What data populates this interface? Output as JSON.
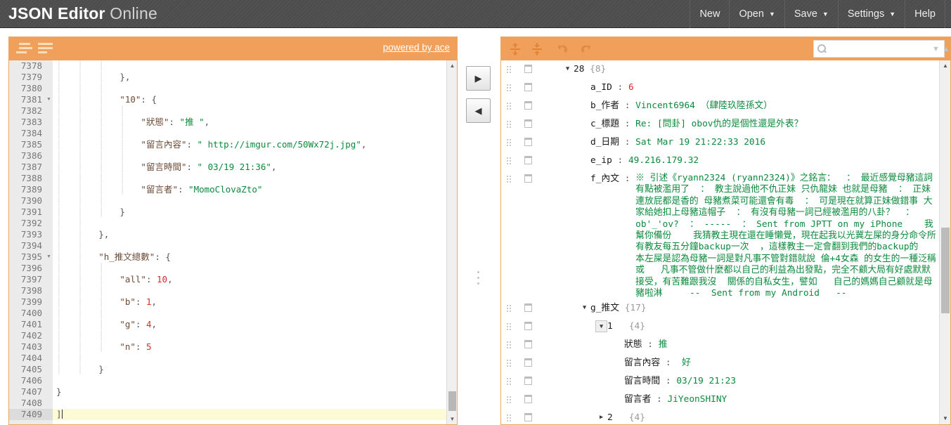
{
  "header": {
    "title_strong": "JSON Editor",
    "title_light": "Online",
    "menu": [
      {
        "label": "New",
        "caret": ""
      },
      {
        "label": "Open",
        "caret": "▼"
      },
      {
        "label": "Save",
        "caret": "▼"
      },
      {
        "label": "Settings",
        "caret": "▼"
      },
      {
        "label": "Help",
        "caret": ""
      }
    ]
  },
  "left_panel": {
    "toolbar": {
      "powered_by": "powered by ace",
      "format_icon": "format-json-icon",
      "compact_icon": "compact-json-icon"
    },
    "editor": {
      "lines": [
        {
          "no": "7378",
          "fold": "",
          "html": "<span class=\"indent-guide\">│   │   │   </span>",
          "active": false
        },
        {
          "no": "7379",
          "fold": "",
          "html": "<span class=\"indent-guide\">│   │   │   </span><span class=\"p\">},</span>",
          "active": false
        },
        {
          "no": "7380",
          "fold": "",
          "html": "<span class=\"indent-guide\">│   │   │   </span>",
          "active": false
        },
        {
          "no": "7381",
          "fold": "▼",
          "html": "<span class=\"indent-guide\">│   │   │   </span><span class=\"k\">\"10\"</span><span class=\"p\">: {</span>",
          "active": false
        },
        {
          "no": "7382",
          "fold": "",
          "html": "<span class=\"indent-guide\">│   │   │   │   </span>",
          "active": false
        },
        {
          "no": "7383",
          "fold": "",
          "html": "<span class=\"indent-guide\">│   │   │   │   </span><span class=\"k\">\"狀態\"</span><span class=\"p\">: </span><span class=\"s\">\"推 \"</span><span class=\"p\">,</span>",
          "active": false
        },
        {
          "no": "7384",
          "fold": "",
          "html": "<span class=\"indent-guide\">│   │   │   │   </span>",
          "active": false
        },
        {
          "no": "7385",
          "fold": "",
          "html": "<span class=\"indent-guide\">│   │   │   │   </span><span class=\"k\">\"留言內容\"</span><span class=\"p\">: </span><span class=\"s\">\" http://imgur.com/50Wx72j.jpg\"</span><span class=\"p\">,</span>",
          "active": false
        },
        {
          "no": "7386",
          "fold": "",
          "html": "<span class=\"indent-guide\">│   │   │   │   </span>",
          "active": false
        },
        {
          "no": "7387",
          "fold": "",
          "html": "<span class=\"indent-guide\">│   │   │   │   </span><span class=\"k\">\"留言時間\"</span><span class=\"p\">: </span><span class=\"s\">\" 03/19 21:36\"</span><span class=\"p\">,</span>",
          "active": false
        },
        {
          "no": "7388",
          "fold": "",
          "html": "<span class=\"indent-guide\">│   │   │   │   </span>",
          "active": false
        },
        {
          "no": "7389",
          "fold": "",
          "html": "<span class=\"indent-guide\">│   │   │   │   </span><span class=\"k\">\"留言者\"</span><span class=\"p\">: </span><span class=\"s\">\"MomoClovaZto\"</span>",
          "active": false
        },
        {
          "no": "7390",
          "fold": "",
          "html": "<span class=\"indent-guide\">│   │   │   </span>",
          "active": false
        },
        {
          "no": "7391",
          "fold": "",
          "html": "<span class=\"indent-guide\">│   │   │   </span><span class=\"p\">}</span>",
          "active": false
        },
        {
          "no": "7392",
          "fold": "",
          "html": "<span class=\"indent-guide\">│   │   </span>",
          "active": false
        },
        {
          "no": "7393",
          "fold": "",
          "html": "<span class=\"indent-guide\">│   │   </span><span class=\"p\">},</span>",
          "active": false
        },
        {
          "no": "7394",
          "fold": "",
          "html": "<span class=\"indent-guide\">│   │   </span>",
          "active": false
        },
        {
          "no": "7395",
          "fold": "▼",
          "html": "<span class=\"indent-guide\">│   │   </span><span class=\"k\">\"h_推文總數\"</span><span class=\"p\">: {</span>",
          "active": false
        },
        {
          "no": "7396",
          "fold": "",
          "html": "<span class=\"indent-guide\">│   │   │   </span>",
          "active": false
        },
        {
          "no": "7397",
          "fold": "",
          "html": "<span class=\"indent-guide\">│   │   │   </span><span class=\"k\">\"all\"</span><span class=\"p\">: </span><span class=\"n\">10</span><span class=\"p\">,</span>",
          "active": false
        },
        {
          "no": "7398",
          "fold": "",
          "html": "<span class=\"indent-guide\">│   │   │   </span>",
          "active": false
        },
        {
          "no": "7399",
          "fold": "",
          "html": "<span class=\"indent-guide\">│   │   │   </span><span class=\"k\">\"b\"</span><span class=\"p\">: </span><span class=\"n\">1</span><span class=\"p\">,</span>",
          "active": false
        },
        {
          "no": "7400",
          "fold": "",
          "html": "<span class=\"indent-guide\">│   │   │   </span>",
          "active": false
        },
        {
          "no": "7401",
          "fold": "",
          "html": "<span class=\"indent-guide\">│   │   │   </span><span class=\"k\">\"g\"</span><span class=\"p\">: </span><span class=\"n\">4</span><span class=\"p\">,</span>",
          "active": false
        },
        {
          "no": "7402",
          "fold": "",
          "html": "<span class=\"indent-guide\">│   │   │   </span>",
          "active": false
        },
        {
          "no": "7403",
          "fold": "",
          "html": "<span class=\"indent-guide\">│   │   │   </span><span class=\"k\">\"n\"</span><span class=\"p\">: </span><span class=\"n\">5</span>",
          "active": false
        },
        {
          "no": "7404",
          "fold": "",
          "html": "<span class=\"indent-guide\">│   │   </span>",
          "active": false
        },
        {
          "no": "7405",
          "fold": "",
          "html": "<span class=\"indent-guide\">│   │   </span><span class=\"p\">}</span>",
          "active": false
        },
        {
          "no": "7406",
          "fold": "",
          "html": "",
          "active": false
        },
        {
          "no": "7407",
          "fold": "",
          "html": "<span class=\"p\">}</span>",
          "active": false
        },
        {
          "no": "7408",
          "fold": "",
          "html": "",
          "active": false
        },
        {
          "no": "7409",
          "fold": "",
          "html": "<span class=\"p\">]</span><span class=\"caret-bar\"></span>",
          "active": true
        }
      ]
    }
  },
  "transfer": {
    "to_tree_label": "▶",
    "to_code_label": "◀"
  },
  "right_panel": {
    "toolbar": {
      "expand_all": "expand-all-icon",
      "collapse_all": "collapse-all-icon",
      "undo": "undo-icon",
      "redo": "redo-icon",
      "search_placeholder": "",
      "search_value": "",
      "search_next": "▼",
      "search_prev": "▲"
    },
    "tree": [
      {
        "indent": 0,
        "expander": "▼",
        "boxed": false,
        "field": "28",
        "sep": " ",
        "count": "{8}",
        "value": "",
        "numeric": false
      },
      {
        "indent": 1,
        "expander": "",
        "boxed": false,
        "field": "a_ID",
        "sep": " : ",
        "count": "",
        "value": "6",
        "numeric": true
      },
      {
        "indent": 1,
        "expander": "",
        "boxed": false,
        "field": "b_作者",
        "sep": " : ",
        "count": "",
        "value": "Vincent6964 （肆陸玖陸孫文）",
        "numeric": false
      },
      {
        "indent": 1,
        "expander": "",
        "boxed": false,
        "field": "c_標題",
        "sep": " : ",
        "count": "",
        "value": "Re: [問卦] obov仇的是個性還是外表？",
        "numeric": false
      },
      {
        "indent": 1,
        "expander": "",
        "boxed": false,
        "field": "d_日期",
        "sep": " : ",
        "count": "",
        "value": "Sat Mar 19 21:22:33 2016",
        "numeric": false
      },
      {
        "indent": 1,
        "expander": "",
        "boxed": false,
        "field": "e_ip",
        "sep": " : ",
        "count": "",
        "value": "49.216.179.32",
        "numeric": false
      },
      {
        "indent": 1,
        "expander": "",
        "boxed": false,
        "field": "f_內文",
        "sep": " : ",
        "count": "",
        "long": true,
        "value": "※ 引述《ryann2324 (ryann2324)》之銘言：  ： 最近感覺母豬這詞有點被濫用了  ： 教主說過他不仇正妹 只仇龍妹 也就是母豬  ： 正妹連放屁都是香的 母豬煮菜可能還會有毒  ： 可是現在就算正妹做錯事 大家給她扣上母豬這帽子  ： 有沒有母豬一詞已經被濫用的八卦？  ： ob'_'ov?  ： -----  ： Sent from JPTT on my iPhone    我幫你備份    我猜教主現在還在睡懶覺，現在起我以光冀左屎的身分命令所有教友每五分鐘backup一次  ，這樣教主一定會翻到我們的backup的   本左屎是認為母豬一詞是對凡事不管對錯就說 倫+4女森 的女生的一種泛稱   或   凡事不管做什麼都以自己的利益為出發點，完全不顧大局有好處默默接受，有苦難跟我沒  關係的自私女生，譬如   自己的媽媽自己顧就是母豬啦淋     --  Sent from my Android   --",
        "numeric": false
      },
      {
        "indent": 1,
        "expander": "▼",
        "boxed": false,
        "field": "g_推文",
        "sep": " ",
        "count": "{17}",
        "value": "",
        "numeric": false
      },
      {
        "indent": 2,
        "expander": "▼",
        "boxed": true,
        "field": "1",
        "sep": "   ",
        "count": "{4}",
        "value": "",
        "numeric": false
      },
      {
        "indent": 3,
        "expander": "",
        "boxed": false,
        "field": "狀態",
        "sep": " : ",
        "count": "",
        "value": "推 ",
        "numeric": false
      },
      {
        "indent": 3,
        "expander": "",
        "boxed": false,
        "field": "留言內容",
        "sep": " : ",
        "count": "",
        "value": " 好",
        "numeric": false
      },
      {
        "indent": 3,
        "expander": "",
        "boxed": false,
        "field": "留言時間",
        "sep": " : ",
        "count": "",
        "value": "03/19 21:23",
        "numeric": false
      },
      {
        "indent": 3,
        "expander": "",
        "boxed": false,
        "field": "留言者",
        "sep": " : ",
        "count": "",
        "value": "JiYeonSHINY",
        "numeric": false
      },
      {
        "indent": 2,
        "expander": "▶",
        "boxed": false,
        "field": "2",
        "sep": "   ",
        "count": "{4}",
        "value": "",
        "numeric": false
      }
    ]
  }
}
